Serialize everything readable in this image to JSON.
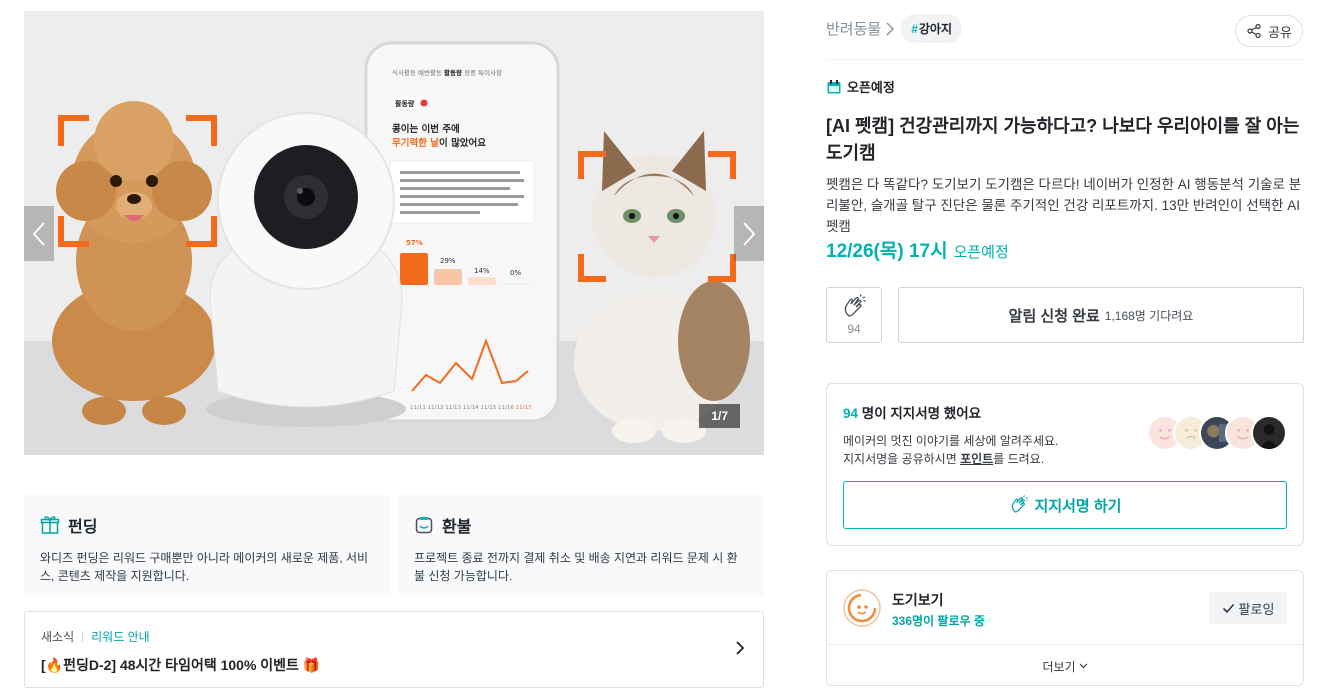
{
  "gallery": {
    "counter": "1/7",
    "prev_icon": "chevron-left-icon",
    "next_icon": "chevron-right-icon",
    "phone": {
      "tabs": [
        "식사활동",
        "배변활동",
        "활동량",
        "정중",
        "특이사항"
      ],
      "section_label": "활동량",
      "heading_line1": "콩이는 이번 주에",
      "heading_line2_accent": "무기력한 날",
      "heading_line2_rest": "이 많았어요",
      "bar_labels": [
        "57%",
        "29%",
        "14%",
        "0%"
      ],
      "x_ticks": [
        "11/11",
        "11/12",
        "11/13",
        "11/14",
        "11/15",
        "11/16",
        "11/17"
      ]
    }
  },
  "funding_card": {
    "icon": "gift-icon",
    "title": "펀딩",
    "desc": "와디즈 펀딩은 리워드 구매뿐만 아니라 메이커의 새로운 제품, 서비스, 콘텐츠 제작을 지원합니다."
  },
  "refund_card": {
    "icon": "refund-icon",
    "title": "환불",
    "desc": "프로젝트 종료 전까지 결제 취소 및 배송 지연과 리워드 문제 시 환불 신청 가능합니다."
  },
  "news": {
    "label": "새소식",
    "category": "리워드 안내",
    "headline": "[🔥펀딩D-2] 48시간 타임어택 100% 이벤트 🎁"
  },
  "breadcrumb": {
    "category": "반려동물",
    "tag_hash": "#",
    "tag": "강아지"
  },
  "share": {
    "label": "공유"
  },
  "project": {
    "status_label": "오픈예정",
    "title": "[AI 펫캠] 건강관리까지 가능하다고? 나보다 우리아이를 잘 아는 도기캠",
    "desc": "펫캠은 다 똑같다? 도기보기 도기캠은 다르다! 네이버가 인정한 AI 행동분석 기술로 분리불안, 슬개골 탈구 진단은 물론 주기적인 건강 리포트까지. 13만 반려인이 선택한 AI 펫캠",
    "open_date": "12/26(목) 17시",
    "open_status": "오픈예정"
  },
  "actions": {
    "like_count": "94",
    "notify_label": "알림 신청 완료",
    "notify_sub": "1,168명 기다려요"
  },
  "support": {
    "count": "94",
    "headline_rest": " 명이 지지서명 했어요",
    "line1": "메이커의 멋진 이야기를 세상에 알려주세요.",
    "line2_prefix": "지지서명을 공유하시면 ",
    "line2_point": "포인트",
    "line2_suffix": "를 드려요.",
    "button": "지지서명 하기"
  },
  "maker": {
    "name": "도기보기",
    "followers": "336명이 팔로우 중",
    "follow_label": "팔로잉",
    "more_label": "더보기"
  },
  "colors": {
    "accent": "#00b2b2",
    "orange": "#f26b1d"
  }
}
